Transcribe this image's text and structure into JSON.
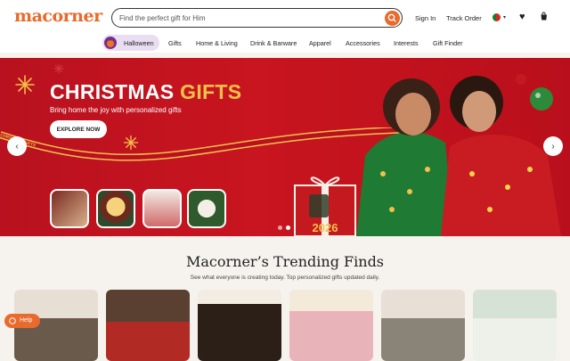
{
  "header": {
    "logo": "macorner",
    "search_placeholder": "Find the perfect gift for Him",
    "sign_in": "Sign In",
    "track_order": "Track Order"
  },
  "nav": {
    "items": [
      "Halloween",
      "Gifts",
      "Home & Living",
      "Drink & Barware",
      "Apparel",
      "Accessories",
      "Interests",
      "Gift Finder"
    ]
  },
  "hero": {
    "title_white": "CHRISTMAS ",
    "title_gold": "GIFTS",
    "subtitle": "Bring home the joy with personalized gifts",
    "cta": "EXPLORE NOW",
    "ribbon_text": "CHRISTMAS GIFTS",
    "gift_box_year": "2026",
    "slide_index": 2,
    "slide_count": 2
  },
  "trending": {
    "title": "Macorner’s Trending Finds",
    "subtitle": "See what everyone is creating today. Top personalized gifts updated daily."
  },
  "help": {
    "label": "Help"
  },
  "colors": {
    "brand": "#e86a2c",
    "hero_red": "#c8151f",
    "gold": "#f3c14a"
  },
  "icons": [
    "search-icon",
    "flag-icon",
    "heart-icon",
    "cart-icon",
    "chevron-left-icon",
    "chevron-right-icon",
    "help-icon"
  ]
}
